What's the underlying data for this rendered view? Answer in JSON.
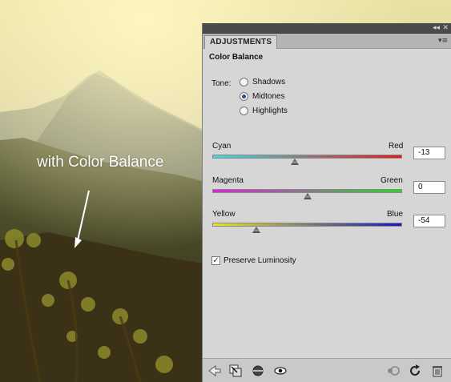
{
  "annotation": {
    "text": "with Color Balance"
  },
  "panel": {
    "tab_label": "ADJUSTMENTS",
    "collapse_icon": "double-chevron-left-icon",
    "close_icon": "close-icon",
    "menu_icon": "panel-menu-icon",
    "heading": "Color Balance",
    "tone": {
      "label": "Tone:",
      "options": [
        {
          "label": "Shadows",
          "selected": false
        },
        {
          "label": "Midtones",
          "selected": true
        },
        {
          "label": "Highlights",
          "selected": false
        }
      ]
    },
    "sliders": [
      {
        "left_label": "Cyan",
        "right_label": "Red",
        "value": "-13",
        "min": -100,
        "max": 100,
        "left_color": "#3fd8e0",
        "right_color": "#e01a1a"
      },
      {
        "left_label": "Magenta",
        "right_label": "Green",
        "value": "0",
        "min": -100,
        "max": 100,
        "left_color": "#e020e0",
        "right_color": "#28d828"
      },
      {
        "left_label": "Yellow",
        "right_label": "Blue",
        "value": "-54",
        "min": -100,
        "max": 100,
        "left_color": "#e6e61c",
        "right_color": "#1818c8"
      }
    ],
    "preserve_luminosity": {
      "label": "Preserve Luminosity",
      "checked": true
    },
    "bottom_icons": [
      "return-arrow-icon",
      "clip-to-layer-icon",
      "layer-visibility-circle-icon",
      "eye-icon",
      "view-previous-state-icon",
      "reset-icon",
      "trash-icon"
    ]
  }
}
